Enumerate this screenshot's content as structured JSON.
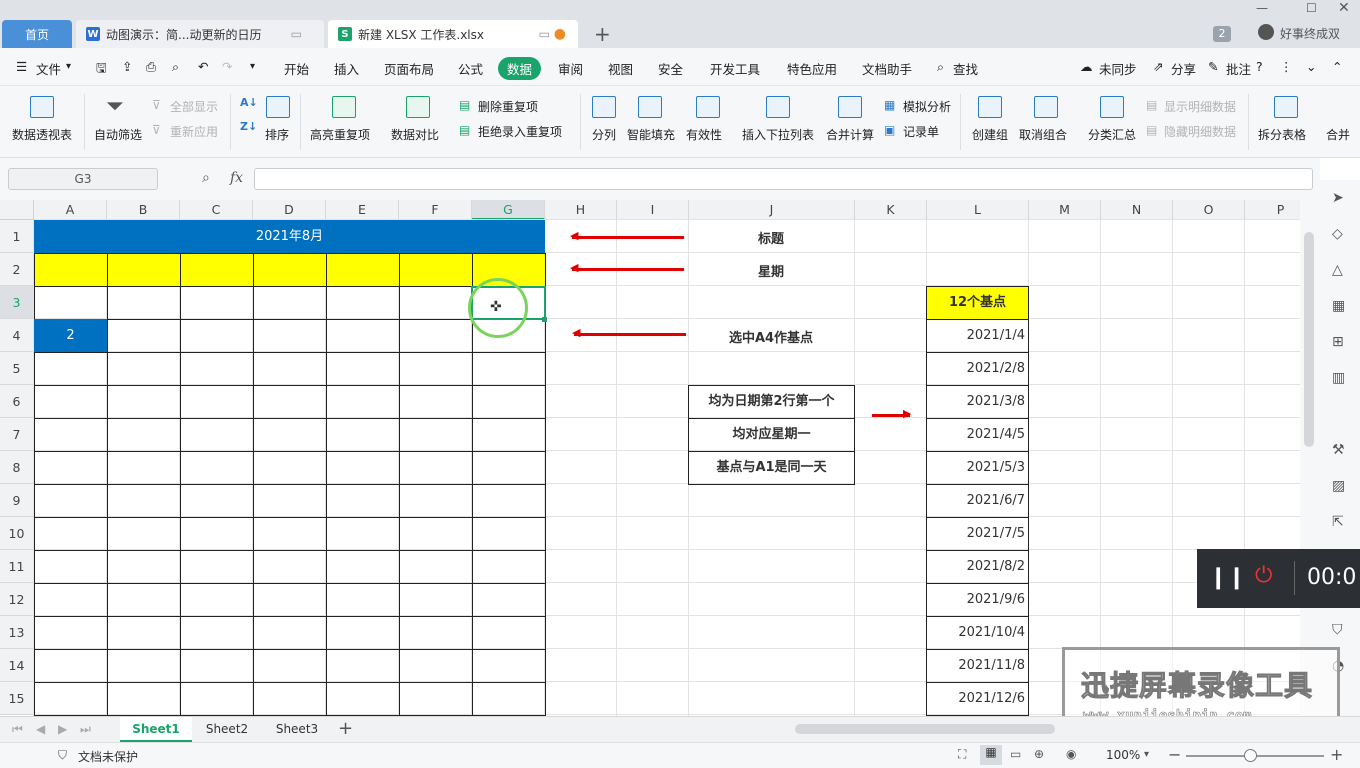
{
  "tabs": {
    "home": "首页",
    "doc": "动图演示：简...动更新的日历",
    "xlsx": "新建 XLSX 工作表.xlsx",
    "badge": "2",
    "user": "好事终成双"
  },
  "menu": {
    "file": "文件",
    "items": [
      "开始",
      "插入",
      "页面布局",
      "公式",
      "数据",
      "审阅",
      "视图",
      "安全",
      "开发工具",
      "特色应用",
      "文档助手"
    ],
    "find": "查找",
    "sync": "未同步",
    "share": "分享",
    "comment": "批注"
  },
  "ribbon": {
    "pivot": "数据透视表",
    "autofilter": "自动筛选",
    "show_all": "全部显示",
    "reapply": "重新应用",
    "sort": "排序",
    "highlight_dup": "高亮重复项",
    "compare": "数据对比",
    "remove_dup": "删除重复项",
    "reject_dup": "拒绝录入重复项",
    "split": "分列",
    "smart_fill": "智能填充",
    "validity": "有效性",
    "dropdown": "插入下拉列表",
    "consolidate": "合并计算",
    "simulate": "模拟分析",
    "record": "记录单",
    "group": "创建组",
    "ungroup": "取消组合",
    "subtotal": "分类汇总",
    "show_detail": "显示明细数据",
    "hide_detail": "隐藏明细数据",
    "split_table": "拆分表格",
    "merge_table": "合并"
  },
  "formula": {
    "namebox": "G3",
    "fx": "fx"
  },
  "columns": [
    "A",
    "B",
    "C",
    "D",
    "E",
    "F",
    "G",
    "H",
    "I",
    "J",
    "K",
    "L",
    "M",
    "N",
    "O",
    "P"
  ],
  "rows": [
    "1",
    "2",
    "3",
    "4",
    "5",
    "6",
    "7",
    "8",
    "9",
    "10",
    "11",
    "12",
    "13",
    "14",
    "15"
  ],
  "cells": {
    "title": "2021年8月",
    "a4": "2",
    "note_title": "标题",
    "note_week": "星期",
    "note_base": "选中A4作基点",
    "box1": "均为日期第2行第一个",
    "box2": "均对应星期一",
    "box3": "基点与A1是同一天",
    "l_header": "12个基点"
  },
  "dates": [
    "2021/1/4",
    "2021/2/8",
    "2021/3/8",
    "2021/4/5",
    "2021/5/3",
    "2021/6/7",
    "2021/7/5",
    "2021/8/2",
    "2021/9/6",
    "2021/10/4",
    "2021/11/8",
    "2021/12/6"
  ],
  "sheets": [
    "Sheet1",
    "Sheet2",
    "Sheet3"
  ],
  "status": {
    "protect": "文档未保护",
    "zoom": "100%"
  },
  "recorder": {
    "time": "00:0"
  },
  "watermark": {
    "title": "迅捷屏幕录像工具",
    "url": "www.xunjieshipin.com"
  },
  "colors": {
    "title_fill": "#0070c0",
    "header_fill": "#ffff00",
    "arrow": "#e00000",
    "tab_active": "#1aa36b"
  }
}
